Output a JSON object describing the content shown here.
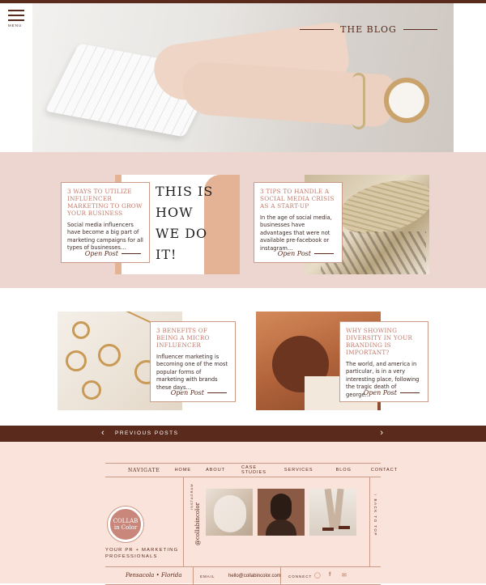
{
  "header": {
    "menu_label": "MENU",
    "blog_title": "THE BLOG"
  },
  "posts": [
    {
      "title": "3 Ways to Utilize Influencer Marketing to Grow Your Business",
      "excerpt": "Social media influencers have become a big part of marketing campaigns for all types of businesses…",
      "cta": "Open Post",
      "shirt_text": "THIS IS HOW WE DO IT!"
    },
    {
      "title": "3 Tips to Handle a Social Media Crisis as a Start-Up",
      "excerpt": "In the age of social media, businesses have advantages that were not available pre-facebook or instagram…",
      "cta": "Open Post"
    },
    {
      "title": "3 Benefits of Being a Micro Influencer",
      "excerpt": "Influencer marketing is becoming one of the most popular forms of marketing with brands these days…",
      "cta": "Open Post"
    },
    {
      "title": "Why Showing Diversity in Your Branding is Important?",
      "excerpt": "The world, and america in particular, is in a very interesting place, following the tragic death of george…",
      "cta": "Open Post"
    }
  ],
  "pagination": {
    "prev_label": "PREVIOUS POSTS",
    "prev_icon": "chevron-left-icon",
    "next_icon": "chevron-right-icon"
  },
  "footer": {
    "nav_label": "NAVIGATE",
    "nav_items": [
      "HOME",
      "ABOUT",
      "CASE STUDIES",
      "SERVICES",
      "BLOG",
      "CONTACT"
    ],
    "logo_text": "COLLAB in Color",
    "tagline": "YOUR PR + MARKETING PROFESSIONALS",
    "instagram_label": "INSTAGRAM",
    "instagram_handle": "@collabincolor",
    "back_to_top": "↑ BACK TO TOP",
    "signature": "Pensacola • Florida",
    "email_label": "EMAIL",
    "email": "hello@collabincolor.com",
    "connect_label": "CONNECT",
    "social_icons": [
      "instagram-icon",
      "facebook-icon",
      "email-icon"
    ]
  },
  "colors": {
    "brown": "#5a2a1c",
    "blush": "#eed6d0",
    "peach": "#fae3da",
    "rose": "#c27a6b"
  }
}
